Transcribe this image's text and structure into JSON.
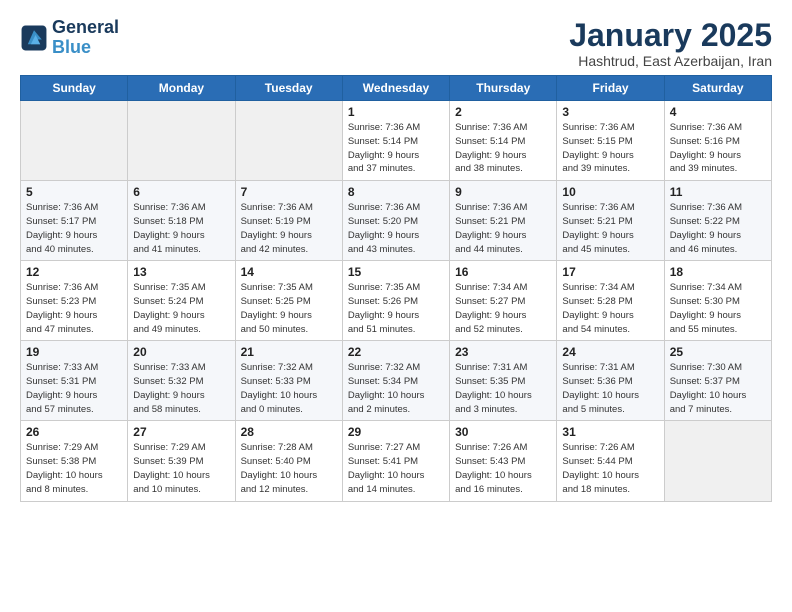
{
  "logo": {
    "line1": "General",
    "line2": "Blue"
  },
  "title": "January 2025",
  "subtitle": "Hashtrud, East Azerbaijan, Iran",
  "headers": [
    "Sunday",
    "Monday",
    "Tuesday",
    "Wednesday",
    "Thursday",
    "Friday",
    "Saturday"
  ],
  "weeks": [
    [
      {
        "num": "",
        "info": ""
      },
      {
        "num": "",
        "info": ""
      },
      {
        "num": "",
        "info": ""
      },
      {
        "num": "1",
        "info": "Sunrise: 7:36 AM\nSunset: 5:14 PM\nDaylight: 9 hours\nand 37 minutes."
      },
      {
        "num": "2",
        "info": "Sunrise: 7:36 AM\nSunset: 5:14 PM\nDaylight: 9 hours\nand 38 minutes."
      },
      {
        "num": "3",
        "info": "Sunrise: 7:36 AM\nSunset: 5:15 PM\nDaylight: 9 hours\nand 39 minutes."
      },
      {
        "num": "4",
        "info": "Sunrise: 7:36 AM\nSunset: 5:16 PM\nDaylight: 9 hours\nand 39 minutes."
      }
    ],
    [
      {
        "num": "5",
        "info": "Sunrise: 7:36 AM\nSunset: 5:17 PM\nDaylight: 9 hours\nand 40 minutes."
      },
      {
        "num": "6",
        "info": "Sunrise: 7:36 AM\nSunset: 5:18 PM\nDaylight: 9 hours\nand 41 minutes."
      },
      {
        "num": "7",
        "info": "Sunrise: 7:36 AM\nSunset: 5:19 PM\nDaylight: 9 hours\nand 42 minutes."
      },
      {
        "num": "8",
        "info": "Sunrise: 7:36 AM\nSunset: 5:20 PM\nDaylight: 9 hours\nand 43 minutes."
      },
      {
        "num": "9",
        "info": "Sunrise: 7:36 AM\nSunset: 5:21 PM\nDaylight: 9 hours\nand 44 minutes."
      },
      {
        "num": "10",
        "info": "Sunrise: 7:36 AM\nSunset: 5:21 PM\nDaylight: 9 hours\nand 45 minutes."
      },
      {
        "num": "11",
        "info": "Sunrise: 7:36 AM\nSunset: 5:22 PM\nDaylight: 9 hours\nand 46 minutes."
      }
    ],
    [
      {
        "num": "12",
        "info": "Sunrise: 7:36 AM\nSunset: 5:23 PM\nDaylight: 9 hours\nand 47 minutes."
      },
      {
        "num": "13",
        "info": "Sunrise: 7:35 AM\nSunset: 5:24 PM\nDaylight: 9 hours\nand 49 minutes."
      },
      {
        "num": "14",
        "info": "Sunrise: 7:35 AM\nSunset: 5:25 PM\nDaylight: 9 hours\nand 50 minutes."
      },
      {
        "num": "15",
        "info": "Sunrise: 7:35 AM\nSunset: 5:26 PM\nDaylight: 9 hours\nand 51 minutes."
      },
      {
        "num": "16",
        "info": "Sunrise: 7:34 AM\nSunset: 5:27 PM\nDaylight: 9 hours\nand 52 minutes."
      },
      {
        "num": "17",
        "info": "Sunrise: 7:34 AM\nSunset: 5:28 PM\nDaylight: 9 hours\nand 54 minutes."
      },
      {
        "num": "18",
        "info": "Sunrise: 7:34 AM\nSunset: 5:30 PM\nDaylight: 9 hours\nand 55 minutes."
      }
    ],
    [
      {
        "num": "19",
        "info": "Sunrise: 7:33 AM\nSunset: 5:31 PM\nDaylight: 9 hours\nand 57 minutes."
      },
      {
        "num": "20",
        "info": "Sunrise: 7:33 AM\nSunset: 5:32 PM\nDaylight: 9 hours\nand 58 minutes."
      },
      {
        "num": "21",
        "info": "Sunrise: 7:32 AM\nSunset: 5:33 PM\nDaylight: 10 hours\nand 0 minutes."
      },
      {
        "num": "22",
        "info": "Sunrise: 7:32 AM\nSunset: 5:34 PM\nDaylight: 10 hours\nand 2 minutes."
      },
      {
        "num": "23",
        "info": "Sunrise: 7:31 AM\nSunset: 5:35 PM\nDaylight: 10 hours\nand 3 minutes."
      },
      {
        "num": "24",
        "info": "Sunrise: 7:31 AM\nSunset: 5:36 PM\nDaylight: 10 hours\nand 5 minutes."
      },
      {
        "num": "25",
        "info": "Sunrise: 7:30 AM\nSunset: 5:37 PM\nDaylight: 10 hours\nand 7 minutes."
      }
    ],
    [
      {
        "num": "26",
        "info": "Sunrise: 7:29 AM\nSunset: 5:38 PM\nDaylight: 10 hours\nand 8 minutes."
      },
      {
        "num": "27",
        "info": "Sunrise: 7:29 AM\nSunset: 5:39 PM\nDaylight: 10 hours\nand 10 minutes."
      },
      {
        "num": "28",
        "info": "Sunrise: 7:28 AM\nSunset: 5:40 PM\nDaylight: 10 hours\nand 12 minutes."
      },
      {
        "num": "29",
        "info": "Sunrise: 7:27 AM\nSunset: 5:41 PM\nDaylight: 10 hours\nand 14 minutes."
      },
      {
        "num": "30",
        "info": "Sunrise: 7:26 AM\nSunset: 5:43 PM\nDaylight: 10 hours\nand 16 minutes."
      },
      {
        "num": "31",
        "info": "Sunrise: 7:26 AM\nSunset: 5:44 PM\nDaylight: 10 hours\nand 18 minutes."
      },
      {
        "num": "",
        "info": ""
      }
    ]
  ]
}
